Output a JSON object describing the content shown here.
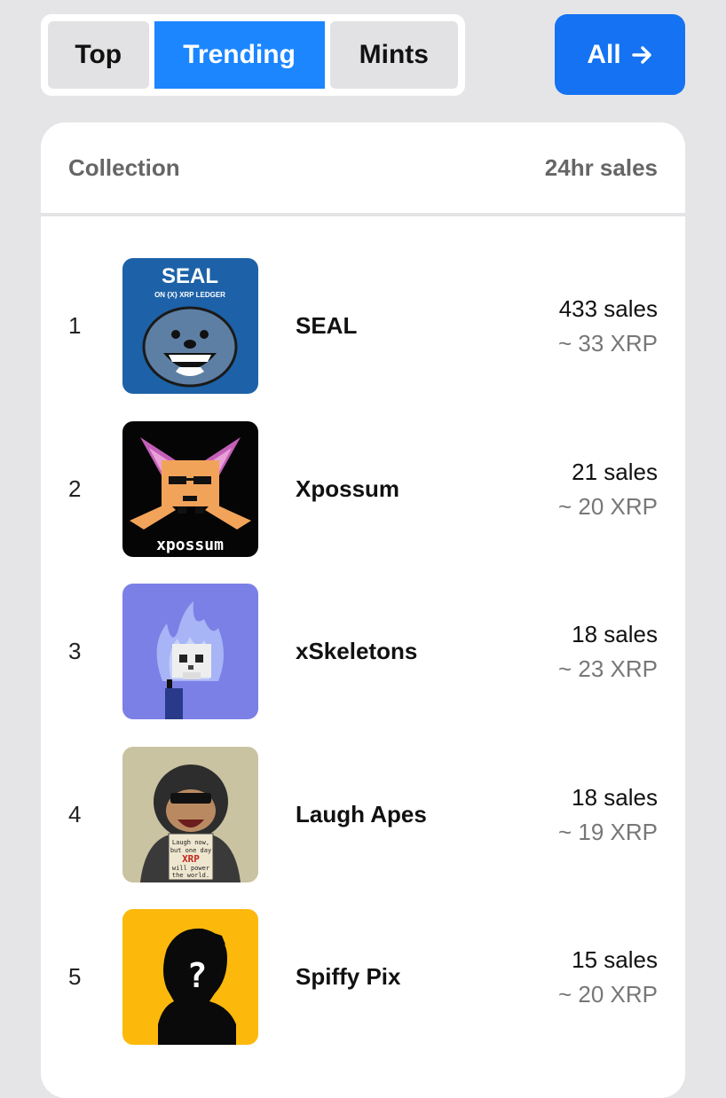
{
  "tabs": [
    {
      "label": "Top",
      "active": false
    },
    {
      "label": "Trending",
      "active": true
    },
    {
      "label": "Mints",
      "active": false
    }
  ],
  "all_button": {
    "label": "All",
    "icon": "arrow-right-icon"
  },
  "table": {
    "col_collection": "Collection",
    "col_sales": "24hr sales"
  },
  "rows": [
    {
      "rank": "1",
      "name": "SEAL",
      "sales": "433 sales",
      "volume": "~ 33 XRP",
      "thumb_text": {
        "title": "SEAL",
        "sub": "ON {X} XRP LEDGER"
      }
    },
    {
      "rank": "2",
      "name": "Xpossum",
      "sales": "21 sales",
      "volume": "~ 20 XRP",
      "thumb_text": {
        "title": "xpossum"
      }
    },
    {
      "rank": "3",
      "name": "xSkeletons",
      "sales": "18 sales",
      "volume": "~ 23 XRP"
    },
    {
      "rank": "4",
      "name": "Laugh Apes",
      "sales": "18 sales",
      "volume": "~ 19 XRP",
      "thumb_text": {
        "line1": "Laugh now,",
        "line2": "but one day",
        "line3": "XRP",
        "line4": "will power",
        "line5": "the world."
      }
    },
    {
      "rank": "5",
      "name": "Spiffy Pix",
      "sales": "15 sales",
      "volume": "~ 20 XRP",
      "thumb_text": {
        "mark": "?"
      }
    }
  ],
  "colors": {
    "accent": "#1c86ff",
    "all_button": "#1472f3",
    "background": "#e5e5e7"
  }
}
